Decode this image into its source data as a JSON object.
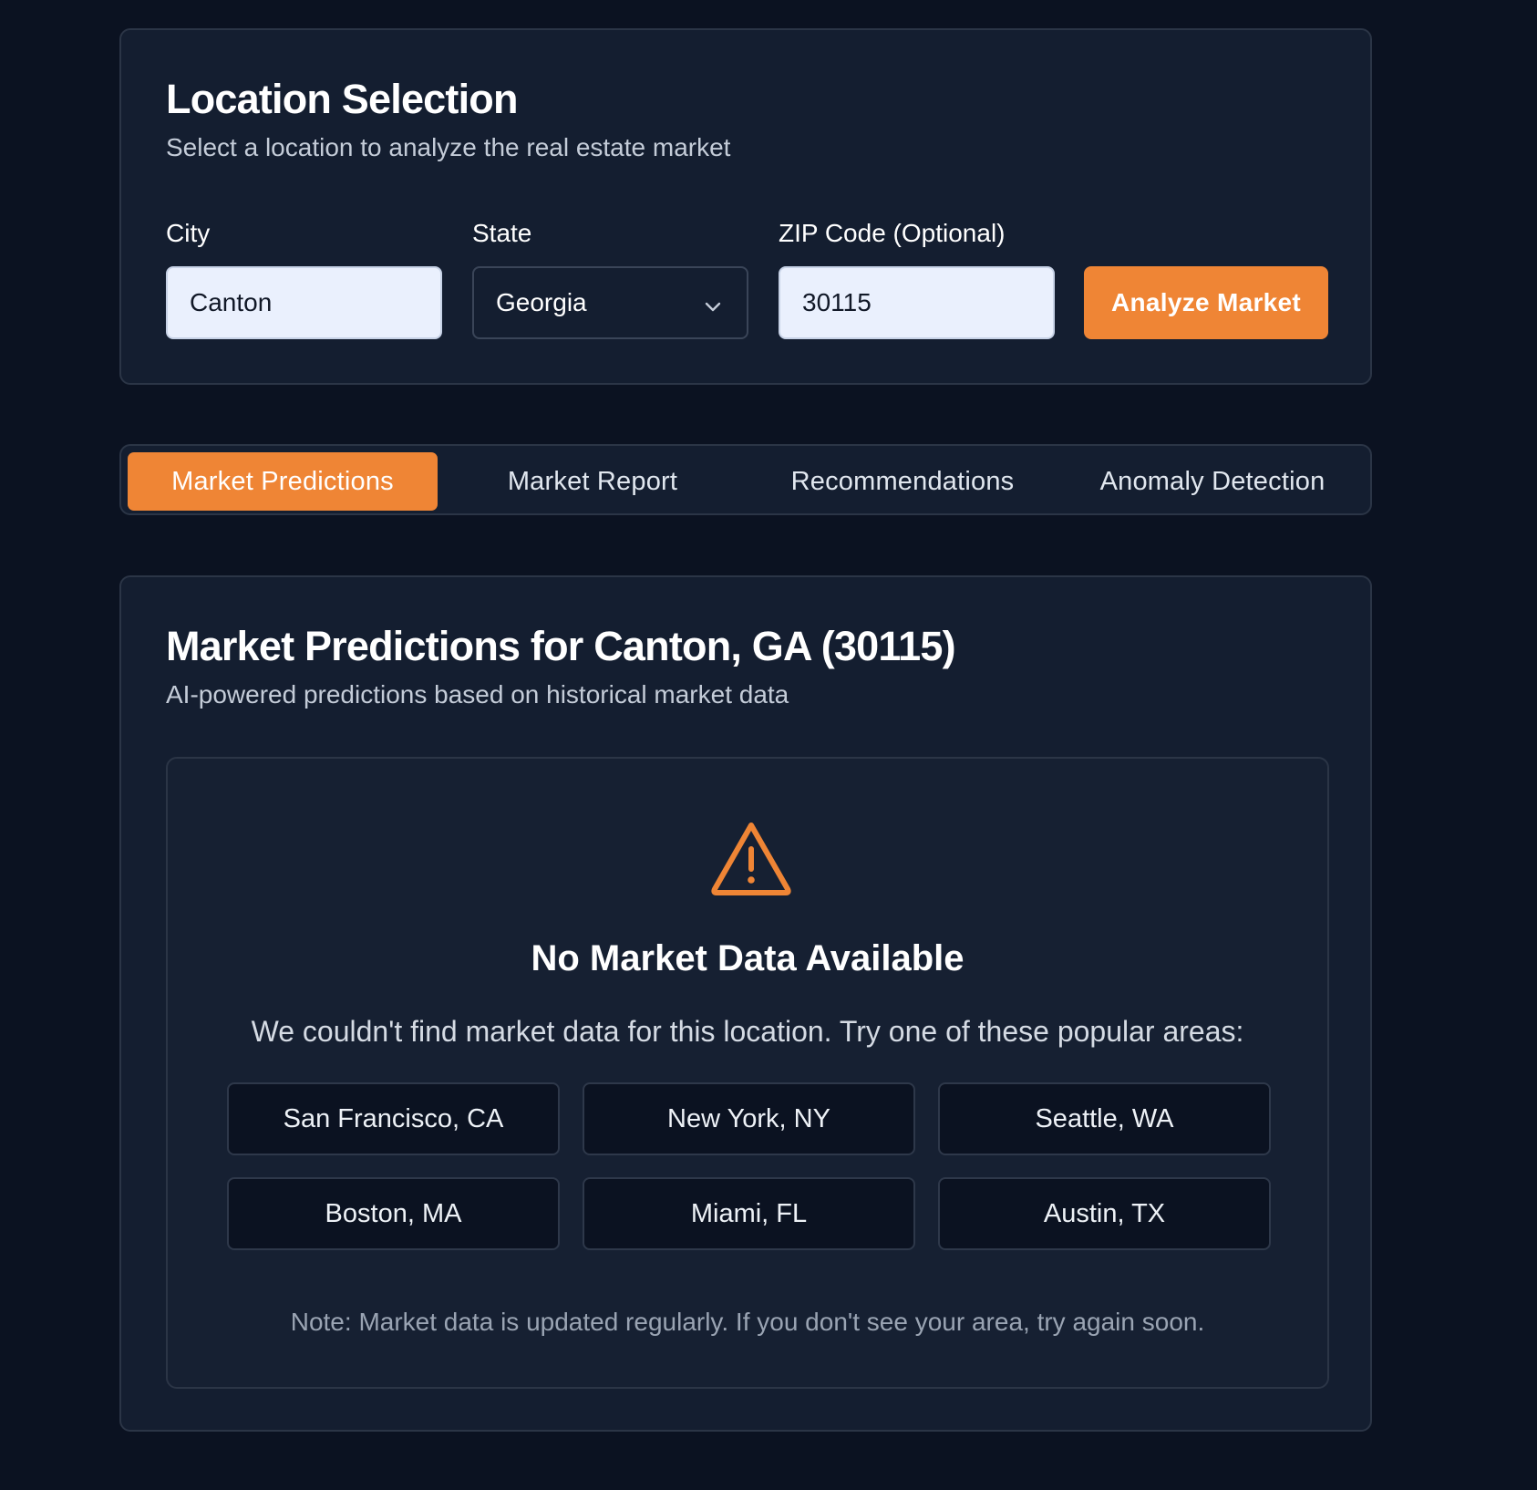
{
  "location": {
    "title": "Location Selection",
    "subtitle": "Select a location to analyze the real estate market",
    "city_label": "City",
    "city_value": "Canton",
    "state_label": "State",
    "state_value": "Georgia",
    "zip_label": "ZIP Code (Optional)",
    "zip_value": "30115",
    "analyze_label": "Analyze Market"
  },
  "tabs": [
    {
      "label": "Market Predictions",
      "active": true
    },
    {
      "label": "Market Report",
      "active": false
    },
    {
      "label": "Recommendations",
      "active": false
    },
    {
      "label": "Anomaly Detection",
      "active": false
    }
  ],
  "predictions": {
    "title": "Market Predictions for Canton, GA (30115)",
    "subtitle": "AI-powered predictions based on historical market data",
    "empty_icon": "warning-triangle-icon",
    "empty_title": "No Market Data Available",
    "empty_message": "We couldn't find market data for this location. Try one of these popular areas:",
    "areas": [
      "San Francisco, CA",
      "New York, NY",
      "Seattle, WA",
      "Boston, MA",
      "Miami, FL",
      "Austin, TX"
    ],
    "note": "Note: Market data is updated regularly. If you don't see your area, try again soon."
  },
  "colors": {
    "background": "#0b1221",
    "card": "#141e30",
    "accent": "#ef8535",
    "input_light": "#eaf0fd"
  }
}
